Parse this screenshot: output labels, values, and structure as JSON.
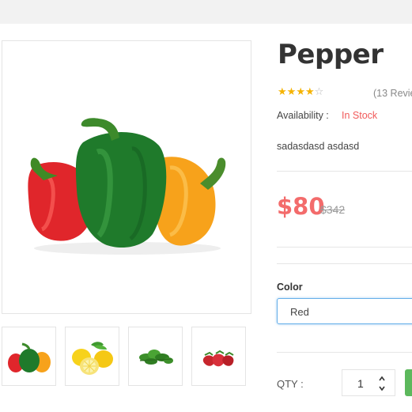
{
  "product": {
    "title": "Pepper",
    "rating": 4,
    "rating_max": 5,
    "reviews": "(13 Revie",
    "availability_label": "Availability :",
    "availability_value": "In Stock",
    "description": "sadasdasd asdasd",
    "price": "$80",
    "old_price": "$342"
  },
  "options": {
    "color_label": "Color",
    "color_value": "Red"
  },
  "quantity": {
    "label": "QTY :",
    "value": "1"
  },
  "gallery": {
    "main": "bell-peppers",
    "thumbnails": [
      "bell-peppers",
      "lemons",
      "herbs",
      "strawberries"
    ]
  },
  "colors": {
    "price": "#f36b6b",
    "stock": "#f15a5a",
    "star": "#f5b301",
    "focus": "#66afe9",
    "cart_button": "#5cb85c"
  }
}
